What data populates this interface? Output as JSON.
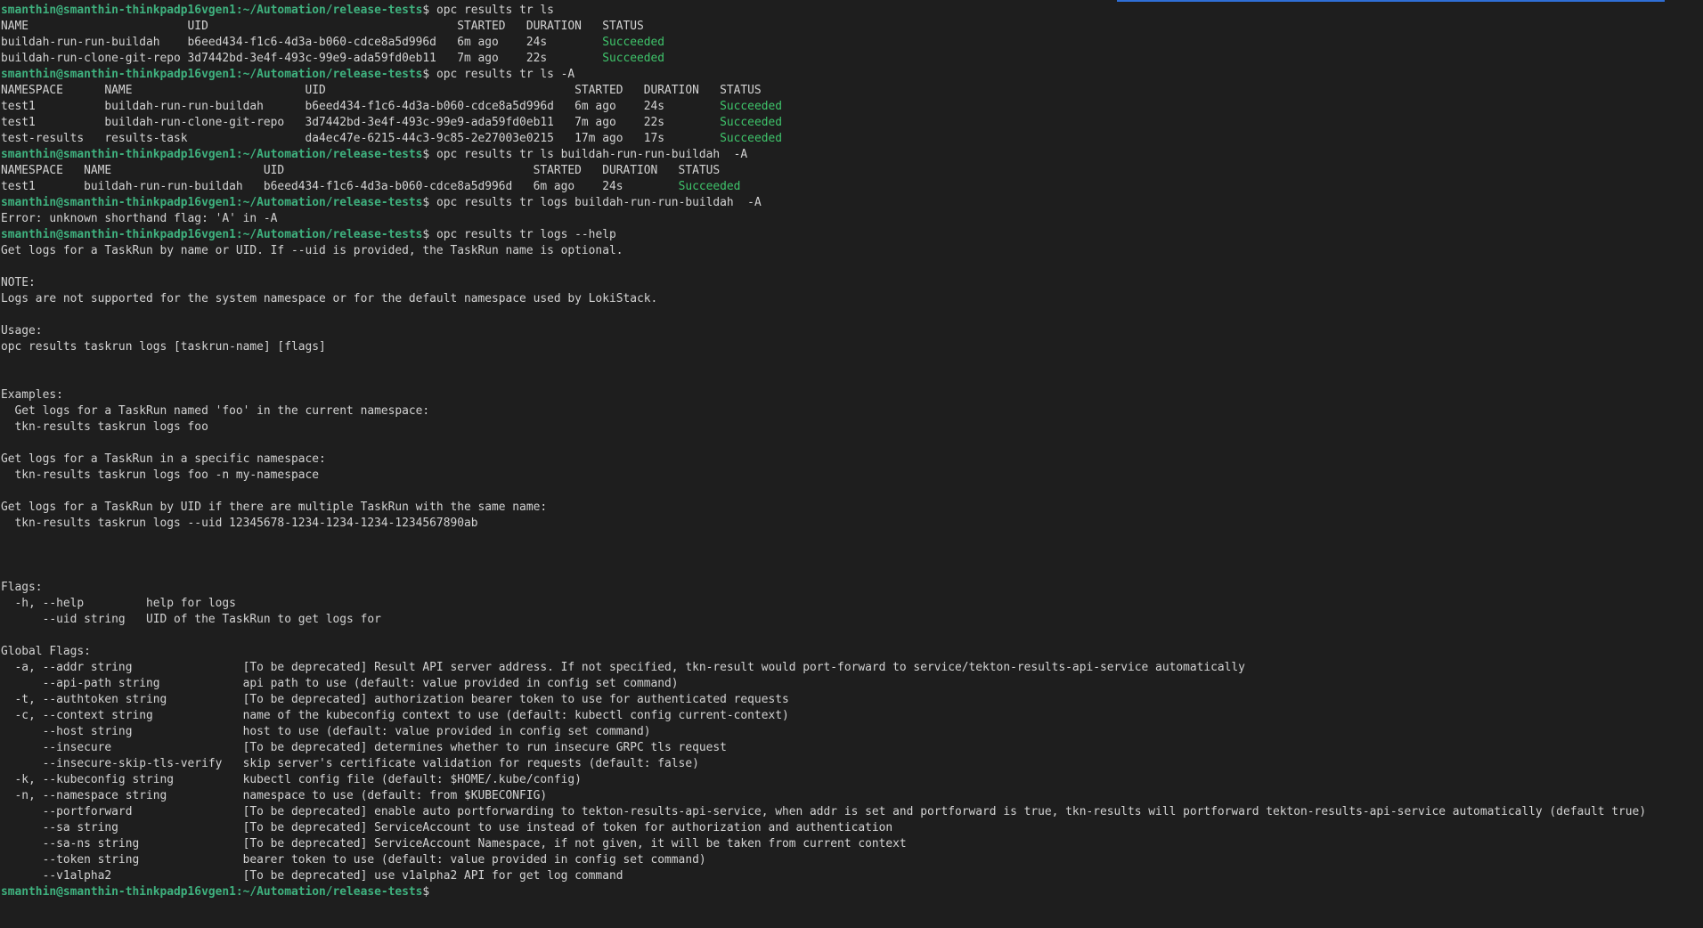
{
  "theme": {
    "background": "#1e1e1e",
    "text": "#d3d3d3",
    "prompt": "#3fb27f",
    "success": "#3fc56b",
    "accent": "#2f6fd6"
  },
  "prompt": "smanthin@smanthin-thinkpadp16vgen1:~/Automation/release-tests",
  "lines": [
    {
      "type": "cmd",
      "text": "$ opc results tr ls"
    },
    {
      "type": "out",
      "text": "NAME                       UID                                    STARTED   DURATION   STATUS"
    },
    {
      "type": "out",
      "text": "buildah-run-run-buildah    b6eed434-f1c6-4d3a-b060-cdce8a5d996d   6m ago    24s        ",
      "status": "Succeeded"
    },
    {
      "type": "out",
      "text": "buildah-run-clone-git-repo 3d7442bd-3e4f-493c-99e9-ada59fd0eb11   7m ago    22s        ",
      "status": "Succeeded"
    },
    {
      "type": "cmd",
      "text": "$ opc results tr ls -A"
    },
    {
      "type": "out",
      "text": "NAMESPACE      NAME                         UID                                    STARTED   DURATION   STATUS"
    },
    {
      "type": "out",
      "text": "test1          buildah-run-run-buildah      b6eed434-f1c6-4d3a-b060-cdce8a5d996d   6m ago    24s        ",
      "status": "Succeeded"
    },
    {
      "type": "out",
      "text": "test1          buildah-run-clone-git-repo   3d7442bd-3e4f-493c-99e9-ada59fd0eb11   7m ago    22s        ",
      "status": "Succeeded"
    },
    {
      "type": "out",
      "text": "test-results   results-task                 da4ec47e-6215-44c3-9c85-2e27003e0215   17m ago   17s        ",
      "status": "Succeeded"
    },
    {
      "type": "cmd",
      "text": "$ opc results tr ls buildah-run-run-buildah  -A"
    },
    {
      "type": "out",
      "text": "NAMESPACE   NAME                      UID                                    STARTED   DURATION   STATUS"
    },
    {
      "type": "out",
      "text": "test1       buildah-run-run-buildah   b6eed434-f1c6-4d3a-b060-cdce8a5d996d   6m ago    24s        ",
      "status": "Succeeded"
    },
    {
      "type": "cmd",
      "text": "$ opc results tr logs buildah-run-run-buildah  -A"
    },
    {
      "type": "out",
      "text": "Error: unknown shorthand flag: 'A' in -A"
    },
    {
      "type": "cmd",
      "text": "$ opc results tr logs --help"
    },
    {
      "type": "out",
      "text": "Get logs for a TaskRun by name or UID. If --uid is provided, the TaskRun name is optional."
    },
    {
      "type": "out",
      "text": ""
    },
    {
      "type": "out",
      "text": "NOTE:"
    },
    {
      "type": "out",
      "text": "Logs are not supported for the system namespace or for the default namespace used by LokiStack."
    },
    {
      "type": "out",
      "text": ""
    },
    {
      "type": "out",
      "text": "Usage:"
    },
    {
      "type": "out",
      "text": "opc results taskrun logs [taskrun-name] [flags]"
    },
    {
      "type": "out",
      "text": ""
    },
    {
      "type": "out",
      "text": ""
    },
    {
      "type": "out",
      "text": "Examples:"
    },
    {
      "type": "out",
      "text": "  Get logs for a TaskRun named 'foo' in the current namespace:"
    },
    {
      "type": "out",
      "text": "  tkn-results taskrun logs foo"
    },
    {
      "type": "out",
      "text": ""
    },
    {
      "type": "out",
      "text": "Get logs for a TaskRun in a specific namespace:"
    },
    {
      "type": "out",
      "text": "  tkn-results taskrun logs foo -n my-namespace"
    },
    {
      "type": "out",
      "text": ""
    },
    {
      "type": "out",
      "text": "Get logs for a TaskRun by UID if there are multiple TaskRun with the same name:"
    },
    {
      "type": "out",
      "text": "  tkn-results taskrun logs --uid 12345678-1234-1234-1234-1234567890ab"
    },
    {
      "type": "out",
      "text": ""
    },
    {
      "type": "out",
      "text": ""
    },
    {
      "type": "out",
      "text": ""
    },
    {
      "type": "out",
      "text": "Flags:"
    },
    {
      "type": "out",
      "text": "  -h, --help         help for logs"
    },
    {
      "type": "out",
      "text": "      --uid string   UID of the TaskRun to get logs for"
    },
    {
      "type": "out",
      "text": ""
    },
    {
      "type": "out",
      "text": "Global Flags:"
    },
    {
      "type": "out",
      "text": "  -a, --addr string                [To be deprecated] Result API server address. If not specified, tkn-result would port-forward to service/tekton-results-api-service automatically"
    },
    {
      "type": "out",
      "text": "      --api-path string            api path to use (default: value provided in config set command)"
    },
    {
      "type": "out",
      "text": "  -t, --authtoken string           [To be deprecated] authorization bearer token to use for authenticated requests"
    },
    {
      "type": "out",
      "text": "  -c, --context string             name of the kubeconfig context to use (default: kubectl config current-context)"
    },
    {
      "type": "out",
      "text": "      --host string                host to use (default: value provided in config set command)"
    },
    {
      "type": "out",
      "text": "      --insecure                   [To be deprecated] determines whether to run insecure GRPC tls request"
    },
    {
      "type": "out",
      "text": "      --insecure-skip-tls-verify   skip server's certificate validation for requests (default: false)"
    },
    {
      "type": "out",
      "text": "  -k, --kubeconfig string          kubectl config file (default: $HOME/.kube/config)"
    },
    {
      "type": "out",
      "text": "  -n, --namespace string           namespace to use (default: from $KUBECONFIG)"
    },
    {
      "type": "out",
      "text": "      --portforward                [To be deprecated] enable auto portforwarding to tekton-results-api-service, when addr is set and portforward is true, tkn-results will portforward tekton-results-api-service automatically (default true)"
    },
    {
      "type": "out",
      "text": "      --sa string                  [To be deprecated] ServiceAccount to use instead of token for authorization and authentication"
    },
    {
      "type": "out",
      "text": "      --sa-ns string               [To be deprecated] ServiceAccount Namespace, if not given, it will be taken from current context"
    },
    {
      "type": "out",
      "text": "      --token string               bearer token to use (default: value provided in config set command)"
    },
    {
      "type": "out",
      "text": "      --v1alpha2                   [To be deprecated] use v1alpha2 API for get log command"
    },
    {
      "type": "cmd",
      "text": "$"
    }
  ]
}
